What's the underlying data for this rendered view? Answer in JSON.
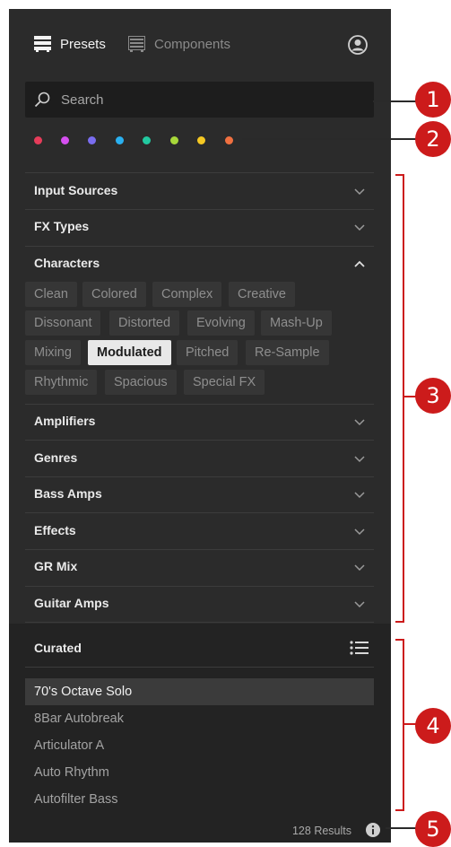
{
  "header": {
    "presets_label": "Presets",
    "components_label": "Components"
  },
  "search": {
    "placeholder": "Search"
  },
  "color_filters": [
    "#e63c5a",
    "#d54ff0",
    "#7a6df0",
    "#2ab0f0",
    "#22c9a0",
    "#a8d83a",
    "#f5c823",
    "#f07040"
  ],
  "filter_sections": {
    "input_sources": "Input Sources",
    "fx_types": "FX Types",
    "characters": "Characters",
    "amplifiers": "Amplifiers",
    "genres": "Genres",
    "bass_amps": "Bass Amps",
    "effects": "Effects",
    "gr_mix": "GR Mix",
    "guitar_amps": "Guitar Amps"
  },
  "character_tags": [
    "Clean",
    "Colored",
    "Complex",
    "Creative",
    "Dissonant",
    "Distorted",
    "Evolving",
    "Mash-Up",
    "Mixing",
    "Modulated",
    "Pitched",
    "Re-Sample",
    "Rhythmic",
    "Spacious",
    "Special FX"
  ],
  "selected_tag": "Modulated",
  "presets": {
    "header": "Curated",
    "items": [
      "70's Octave Solo",
      "8Bar Autobreak",
      "Articulator A",
      "Auto Rhythm",
      "Autofilter Bass"
    ],
    "selected": "70's Octave Solo"
  },
  "results_label": "128 Results",
  "callouts": [
    "1",
    "2",
    "3",
    "4",
    "5"
  ],
  "colors": {
    "panel": "#2b2b2b",
    "callout": "#cc1b1b"
  }
}
